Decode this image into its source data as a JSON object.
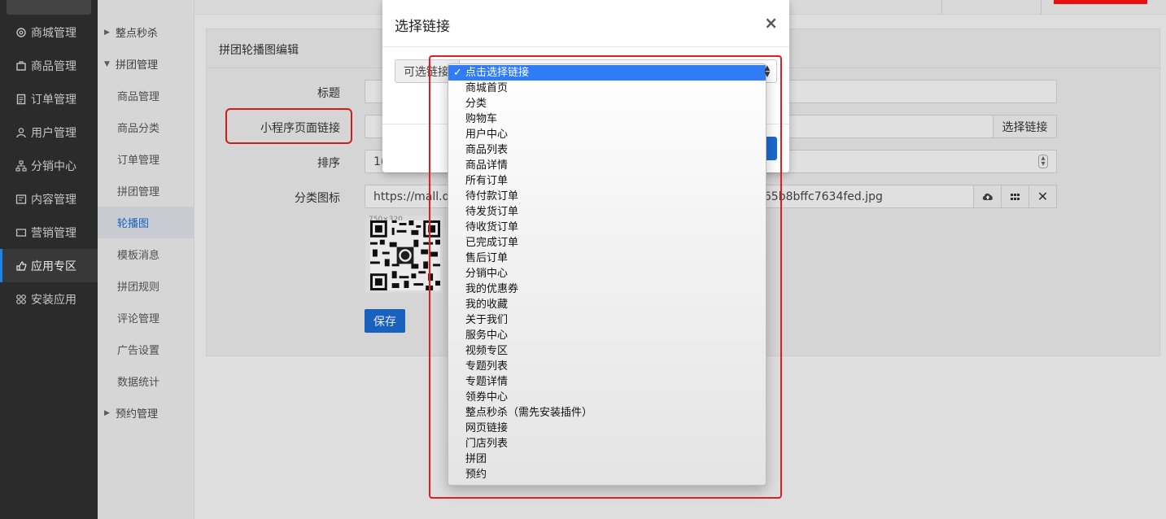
{
  "sidebar": {
    "items": [
      {
        "label": "商城管理",
        "icon": "gear-icon"
      },
      {
        "label": "商品管理",
        "icon": "box-icon"
      },
      {
        "label": "订单管理",
        "icon": "document-icon"
      },
      {
        "label": "用户管理",
        "icon": "user-icon"
      },
      {
        "label": "分销中心",
        "icon": "network-icon"
      },
      {
        "label": "内容管理",
        "icon": "content-icon"
      },
      {
        "label": "营销管理",
        "icon": "ticket-icon"
      },
      {
        "label": "应用专区",
        "icon": "hand-icon"
      },
      {
        "label": "安装应用",
        "icon": "apps-icon"
      }
    ],
    "active_index": 7
  },
  "subnav": {
    "items": [
      {
        "label": "整点秒杀",
        "group": true,
        "expanded": false
      },
      {
        "label": "拼团管理",
        "group": true,
        "expanded": true
      },
      {
        "label": "商品管理"
      },
      {
        "label": "商品分类"
      },
      {
        "label": "订单管理"
      },
      {
        "label": "拼团管理"
      },
      {
        "label": "轮播图",
        "active": true
      },
      {
        "label": "模板消息"
      },
      {
        "label": "拼团规则"
      },
      {
        "label": "评论管理"
      },
      {
        "label": "广告设置"
      },
      {
        "label": "数据统计"
      },
      {
        "label": "预约管理",
        "group": true,
        "expanded": false
      }
    ]
  },
  "panel": {
    "title": "拼团轮播图编辑",
    "fields": {
      "title_label": "标题",
      "link_label": "小程序页面链接",
      "link_button": "选择链接",
      "sort_label": "排序",
      "sort_value": "1(",
      "icon_label": "分类图标",
      "icon_url_start": "https://mall.der",
      "icon_url_end": "d65b8bffc7634fed.jpg",
      "qr_size": "750×320"
    },
    "save_label": "保存"
  },
  "modal": {
    "title": "选择链接",
    "close": "×",
    "addon_label": "可选链接"
  },
  "dropdown": {
    "options": [
      "点击选择链接",
      "商城首页",
      "分类",
      "购物车",
      "用户中心",
      "商品列表",
      "商品详情",
      "所有订单",
      "待付款订单",
      "待发货订单",
      "待收货订单",
      "已完成订单",
      "售后订单",
      "分销中心",
      "我的优惠券",
      "我的收藏",
      "关于我们",
      "服务中心",
      "视频专区",
      "专题列表",
      "专题详情",
      "领券中心",
      "整点秒杀（需先安装插件）",
      "网页链接",
      "门店列表",
      "拼团",
      "预约"
    ],
    "selected_index": 0,
    "check": "✓"
  },
  "colors": {
    "accent": "#1b6ad0",
    "highlight": "#e02020",
    "selection": "#2f7cf6"
  }
}
